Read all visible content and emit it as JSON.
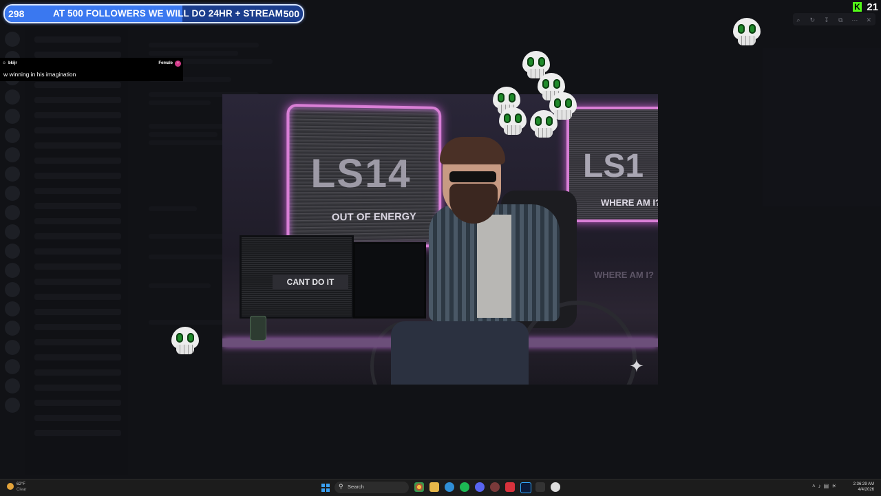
{
  "goal": {
    "current": "298",
    "text": "AT 500 FOLLOWERS WE WILL DO 24HR + STREAM",
    "target": "500",
    "progress": 0.596
  },
  "chat_message": {
    "username": "bkijr",
    "gender": "Female",
    "text": "w winning in his imagination"
  },
  "image": {
    "sign_left_big": "LS14",
    "sign_left_small": "OUT OF ENERGY",
    "sign_right_big": "LS1",
    "sign_right_small": "WHERE AM I?",
    "monitor_label": "CANT DO IT",
    "wall_text": "WHERE AM I?"
  },
  "kick": {
    "logo": "K",
    "viewers": "21"
  },
  "taskbar": {
    "weather_temp": "62°F",
    "weather_cond": "Clear",
    "search_placeholder": "Search",
    "time": "2:36:29 AM",
    "date": "4/4/2026"
  },
  "colors": {
    "goal_bg": "#1b3d8c",
    "goal_fill": "#3a78f0",
    "kick_green": "#53fc18",
    "skull_eye": "#1f8a2a"
  }
}
